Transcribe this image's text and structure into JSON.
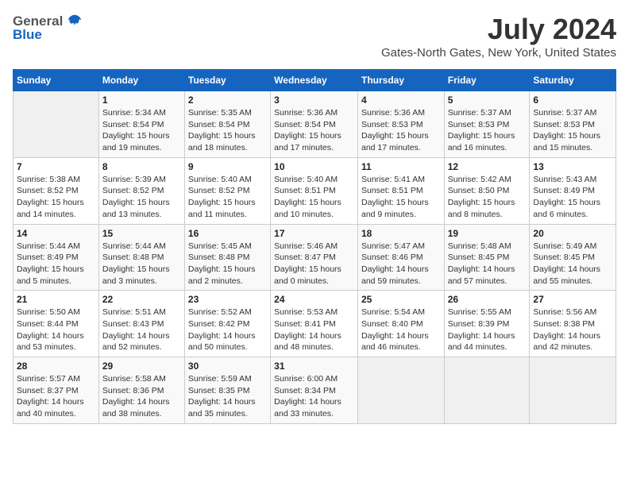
{
  "logo": {
    "general": "General",
    "blue": "Blue"
  },
  "title": "July 2024",
  "location": "Gates-North Gates, New York, United States",
  "days_of_week": [
    "Sunday",
    "Monday",
    "Tuesday",
    "Wednesday",
    "Thursday",
    "Friday",
    "Saturday"
  ],
  "weeks": [
    [
      {
        "day": "",
        "empty": true
      },
      {
        "day": "1",
        "sunrise": "Sunrise: 5:34 AM",
        "sunset": "Sunset: 8:54 PM",
        "daylight": "Daylight: 15 hours and 19 minutes."
      },
      {
        "day": "2",
        "sunrise": "Sunrise: 5:35 AM",
        "sunset": "Sunset: 8:54 PM",
        "daylight": "Daylight: 15 hours and 18 minutes."
      },
      {
        "day": "3",
        "sunrise": "Sunrise: 5:36 AM",
        "sunset": "Sunset: 8:54 PM",
        "daylight": "Daylight: 15 hours and 17 minutes."
      },
      {
        "day": "4",
        "sunrise": "Sunrise: 5:36 AM",
        "sunset": "Sunset: 8:53 PM",
        "daylight": "Daylight: 15 hours and 17 minutes."
      },
      {
        "day": "5",
        "sunrise": "Sunrise: 5:37 AM",
        "sunset": "Sunset: 8:53 PM",
        "daylight": "Daylight: 15 hours and 16 minutes."
      },
      {
        "day": "6",
        "sunrise": "Sunrise: 5:37 AM",
        "sunset": "Sunset: 8:53 PM",
        "daylight": "Daylight: 15 hours and 15 minutes."
      }
    ],
    [
      {
        "day": "7",
        "sunrise": "Sunrise: 5:38 AM",
        "sunset": "Sunset: 8:52 PM",
        "daylight": "Daylight: 15 hours and 14 minutes."
      },
      {
        "day": "8",
        "sunrise": "Sunrise: 5:39 AM",
        "sunset": "Sunset: 8:52 PM",
        "daylight": "Daylight: 15 hours and 13 minutes."
      },
      {
        "day": "9",
        "sunrise": "Sunrise: 5:40 AM",
        "sunset": "Sunset: 8:52 PM",
        "daylight": "Daylight: 15 hours and 11 minutes."
      },
      {
        "day": "10",
        "sunrise": "Sunrise: 5:40 AM",
        "sunset": "Sunset: 8:51 PM",
        "daylight": "Daylight: 15 hours and 10 minutes."
      },
      {
        "day": "11",
        "sunrise": "Sunrise: 5:41 AM",
        "sunset": "Sunset: 8:51 PM",
        "daylight": "Daylight: 15 hours and 9 minutes."
      },
      {
        "day": "12",
        "sunrise": "Sunrise: 5:42 AM",
        "sunset": "Sunset: 8:50 PM",
        "daylight": "Daylight: 15 hours and 8 minutes."
      },
      {
        "day": "13",
        "sunrise": "Sunrise: 5:43 AM",
        "sunset": "Sunset: 8:49 PM",
        "daylight": "Daylight: 15 hours and 6 minutes."
      }
    ],
    [
      {
        "day": "14",
        "sunrise": "Sunrise: 5:44 AM",
        "sunset": "Sunset: 8:49 PM",
        "daylight": "Daylight: 15 hours and 5 minutes."
      },
      {
        "day": "15",
        "sunrise": "Sunrise: 5:44 AM",
        "sunset": "Sunset: 8:48 PM",
        "daylight": "Daylight: 15 hours and 3 minutes."
      },
      {
        "day": "16",
        "sunrise": "Sunrise: 5:45 AM",
        "sunset": "Sunset: 8:48 PM",
        "daylight": "Daylight: 15 hours and 2 minutes."
      },
      {
        "day": "17",
        "sunrise": "Sunrise: 5:46 AM",
        "sunset": "Sunset: 8:47 PM",
        "daylight": "Daylight: 15 hours and 0 minutes."
      },
      {
        "day": "18",
        "sunrise": "Sunrise: 5:47 AM",
        "sunset": "Sunset: 8:46 PM",
        "daylight": "Daylight: 14 hours and 59 minutes."
      },
      {
        "day": "19",
        "sunrise": "Sunrise: 5:48 AM",
        "sunset": "Sunset: 8:45 PM",
        "daylight": "Daylight: 14 hours and 57 minutes."
      },
      {
        "day": "20",
        "sunrise": "Sunrise: 5:49 AM",
        "sunset": "Sunset: 8:45 PM",
        "daylight": "Daylight: 14 hours and 55 minutes."
      }
    ],
    [
      {
        "day": "21",
        "sunrise": "Sunrise: 5:50 AM",
        "sunset": "Sunset: 8:44 PM",
        "daylight": "Daylight: 14 hours and 53 minutes."
      },
      {
        "day": "22",
        "sunrise": "Sunrise: 5:51 AM",
        "sunset": "Sunset: 8:43 PM",
        "daylight": "Daylight: 14 hours and 52 minutes."
      },
      {
        "day": "23",
        "sunrise": "Sunrise: 5:52 AM",
        "sunset": "Sunset: 8:42 PM",
        "daylight": "Daylight: 14 hours and 50 minutes."
      },
      {
        "day": "24",
        "sunrise": "Sunrise: 5:53 AM",
        "sunset": "Sunset: 8:41 PM",
        "daylight": "Daylight: 14 hours and 48 minutes."
      },
      {
        "day": "25",
        "sunrise": "Sunrise: 5:54 AM",
        "sunset": "Sunset: 8:40 PM",
        "daylight": "Daylight: 14 hours and 46 minutes."
      },
      {
        "day": "26",
        "sunrise": "Sunrise: 5:55 AM",
        "sunset": "Sunset: 8:39 PM",
        "daylight": "Daylight: 14 hours and 44 minutes."
      },
      {
        "day": "27",
        "sunrise": "Sunrise: 5:56 AM",
        "sunset": "Sunset: 8:38 PM",
        "daylight": "Daylight: 14 hours and 42 minutes."
      }
    ],
    [
      {
        "day": "28",
        "sunrise": "Sunrise: 5:57 AM",
        "sunset": "Sunset: 8:37 PM",
        "daylight": "Daylight: 14 hours and 40 minutes."
      },
      {
        "day": "29",
        "sunrise": "Sunrise: 5:58 AM",
        "sunset": "Sunset: 8:36 PM",
        "daylight": "Daylight: 14 hours and 38 minutes."
      },
      {
        "day": "30",
        "sunrise": "Sunrise: 5:59 AM",
        "sunset": "Sunset: 8:35 PM",
        "daylight": "Daylight: 14 hours and 35 minutes."
      },
      {
        "day": "31",
        "sunrise": "Sunrise: 6:00 AM",
        "sunset": "Sunset: 8:34 PM",
        "daylight": "Daylight: 14 hours and 33 minutes."
      },
      {
        "day": "",
        "empty": true
      },
      {
        "day": "",
        "empty": true
      },
      {
        "day": "",
        "empty": true
      }
    ]
  ]
}
